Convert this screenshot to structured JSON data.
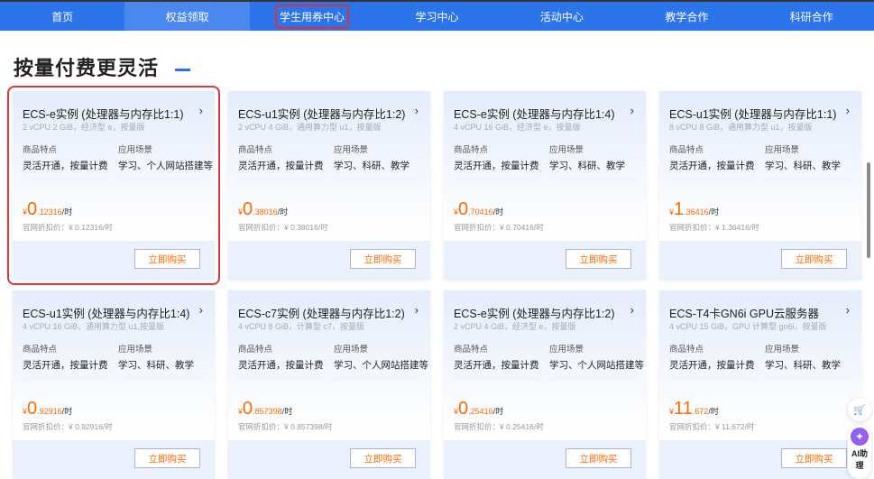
{
  "nav": [
    "首页",
    "权益领取",
    "学生用券中心",
    "学习中心",
    "活动中心",
    "教学合作",
    "科研合作"
  ],
  "nav_active": 1,
  "nav_highlight": 2,
  "section_title": "按量付费更灵活",
  "labels": {
    "features": "商品特点",
    "scenarios": "应用场景",
    "official_prefix": "官网折扣价：",
    "currency": "¥",
    "unit": "/时",
    "buy": "立即购买"
  },
  "cards": [
    {
      "title": "ECS-e实例 (处理器与内存比1:1)",
      "sub": "2 vCPU 2 GiB，经济型 e，按量版",
      "feature": "灵活开通，按量计费",
      "scenario": "学习、个人网站搭建等",
      "price_int": "0",
      "price_dec": ".12316",
      "official": "¥ 0.12316/时"
    },
    {
      "title": "ECS-u1实例 (处理器与内存比1:2)",
      "sub": "2 vCPU 4 GiB，通用算力型 u1，按量版",
      "feature": "灵活开通，按量计费",
      "scenario": "学习、科研、教学",
      "price_int": "0",
      "price_dec": ".38016",
      "official": "¥ 0.38016/时"
    },
    {
      "title": "ECS-e实例 (处理器与内存比1:4)",
      "sub": "4 vCPU 16 GiB，经济型 e，按量版",
      "feature": "灵活开通，按量计费",
      "scenario": "学习、科研、教学",
      "price_int": "0",
      "price_dec": ".70416",
      "official": "¥ 0.70416/时"
    },
    {
      "title": "ECS-u1实例 (处理器与内存比1:1)",
      "sub": "8 vCPU 8 GiB，通用算力型 u1，按量版",
      "feature": "灵活开通，按量计费",
      "scenario": "学习、科研、教学",
      "price_int": "1",
      "price_dec": ".36416",
      "official": "¥ 1.36416/时"
    },
    {
      "title": "ECS-u1实例 (处理器与内存比1:4)",
      "sub": "4 vCPU 16 GiB，通用算力型 u1,按量版",
      "feature": "灵活开通，按量计费",
      "scenario": "学习、科研、教学",
      "price_int": "0",
      "price_dec": ".92916",
      "official": "¥ 0.92916/时"
    },
    {
      "title": "ECS-c7实例 (处理器与内存比1:2)",
      "sub": "4 vCPU 8 GiB，计算型 c7，按量版",
      "feature": "灵活开通，按量计费",
      "scenario": "学习、个人网站搭建等",
      "price_int": "0",
      "price_dec": ".857398",
      "official": "¥ 0.857398/时"
    },
    {
      "title": "ECS-e实例 (处理器与内存比1:2)",
      "sub": "2 vCPU 4 GiB，经济型 e，按量版",
      "feature": "灵活开通，按量计费",
      "scenario": "学习、个人网站搭建等",
      "price_int": "0",
      "price_dec": ".25416",
      "official": "¥ 0.25416/时"
    },
    {
      "title": "ECS-T4卡GN6i GPU云服务器",
      "sub": "4 vCPU 15 GiB，GPU 计算型 gn6i，按量版",
      "feature": "灵活开通，按量计费",
      "scenario": "学习、科研、教学",
      "price_int": "11",
      "price_dec": ".672",
      "official": "¥ 11.672/时"
    }
  ],
  "selected_card": 0,
  "float": {
    "ai_label": "AI助理"
  }
}
